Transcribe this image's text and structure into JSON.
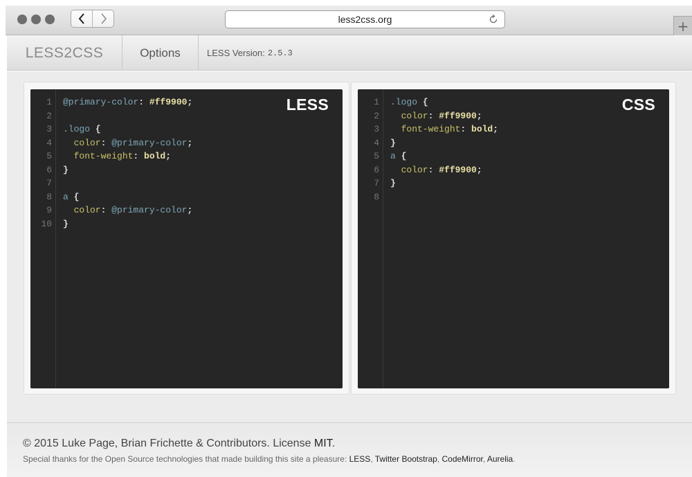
{
  "browser": {
    "url": "less2css.org",
    "icons": {
      "back": "chevron-left-icon",
      "forward": "chevron-right-icon",
      "reload": "reload-icon",
      "new_tab": "plus-icon"
    },
    "new_tab_label": "+"
  },
  "nav": {
    "brand": "LESS2CSS",
    "options_label": "Options",
    "version_label": "LESS Version:",
    "version_value": "2.5.3"
  },
  "less_editor": {
    "tag": "LESS",
    "lines": [
      [
        {
          "t": "@primary-color",
          "c": "var"
        },
        {
          "t": ": ",
          "c": "punc"
        },
        {
          "t": "#ff9900",
          "c": "val"
        },
        {
          "t": ";",
          "c": "punc"
        }
      ],
      [],
      [
        {
          "t": ".logo",
          "c": "sel"
        },
        {
          "t": " {",
          "c": "punc"
        }
      ],
      [
        {
          "t": "  color",
          "c": "prop"
        },
        {
          "t": ": ",
          "c": "punc"
        },
        {
          "t": "@primary-color",
          "c": "var"
        },
        {
          "t": ";",
          "c": "punc"
        }
      ],
      [
        {
          "t": "  font-weight",
          "c": "prop"
        },
        {
          "t": ": ",
          "c": "punc"
        },
        {
          "t": "bold",
          "c": "val"
        },
        {
          "t": ";",
          "c": "punc"
        }
      ],
      [
        {
          "t": "}",
          "c": "punc"
        }
      ],
      [],
      [
        {
          "t": "a",
          "c": "sel"
        },
        {
          "t": " {",
          "c": "punc"
        }
      ],
      [
        {
          "t": "  color",
          "c": "prop"
        },
        {
          "t": ": ",
          "c": "punc"
        },
        {
          "t": "@primary-color",
          "c": "var"
        },
        {
          "t": ";",
          "c": "punc"
        }
      ],
      [
        {
          "t": "}",
          "c": "punc"
        }
      ]
    ]
  },
  "css_editor": {
    "tag": "CSS",
    "lines": [
      [
        {
          "t": ".logo",
          "c": "sel"
        },
        {
          "t": " {",
          "c": "punc"
        }
      ],
      [
        {
          "t": "  color",
          "c": "prop"
        },
        {
          "t": ": ",
          "c": "punc"
        },
        {
          "t": "#ff9900",
          "c": "val"
        },
        {
          "t": ";",
          "c": "punc"
        }
      ],
      [
        {
          "t": "  font-weight",
          "c": "prop"
        },
        {
          "t": ": ",
          "c": "punc"
        },
        {
          "t": "bold",
          "c": "val"
        },
        {
          "t": ";",
          "c": "punc"
        }
      ],
      [
        {
          "t": "}",
          "c": "punc"
        }
      ],
      [
        {
          "t": "a",
          "c": "sel"
        },
        {
          "t": " {",
          "c": "punc"
        }
      ],
      [
        {
          "t": "  color",
          "c": "prop"
        },
        {
          "t": ": ",
          "c": "punc"
        },
        {
          "t": "#ff9900",
          "c": "val"
        },
        {
          "t": ";",
          "c": "punc"
        }
      ],
      [
        {
          "t": "}",
          "c": "punc"
        }
      ],
      []
    ]
  },
  "footer": {
    "copyright_prefix": "© 2015 Luke Page, Brian Frichette & Contributors. License ",
    "license_link": "MIT",
    "copyright_suffix": ".",
    "thanks_prefix": "Special thanks for the Open Source technologies that made building this site a pleasure: ",
    "thanks_links": [
      "LESS",
      "Twitter Bootstrap",
      "CodeMirror",
      "Aurelia"
    ],
    "thanks_suffix": "."
  },
  "colors": {
    "editor_bg": "#262626",
    "variable": "#7fa6b8",
    "property": "#c9c26a",
    "value": "#e8e0a6"
  }
}
